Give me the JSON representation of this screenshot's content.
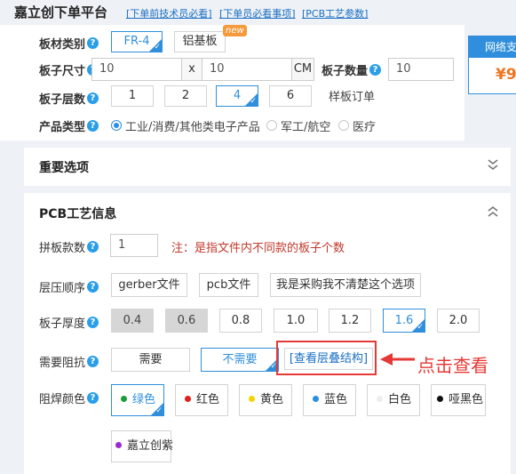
{
  "header": {
    "title": "嘉立创下单平台",
    "links": [
      "[下单前技术员必看]",
      "[下单员必看事项]",
      "[PCB工艺参数]"
    ]
  },
  "board_material": {
    "label": "板材类别",
    "options": [
      "FR-4",
      "铝基板"
    ],
    "selected": "FR-4",
    "new_badge": "new"
  },
  "board_size": {
    "label": "板子尺寸",
    "width": "10",
    "separator": "x",
    "height": "10",
    "unit": "CM"
  },
  "board_quantity": {
    "label": "板子数量",
    "value": "10"
  },
  "layers": {
    "label": "板子层数",
    "options": [
      "1",
      "2",
      "4",
      "6"
    ],
    "selected": "4",
    "sample_note": "样板订单"
  },
  "product_type": {
    "label": "产品类型",
    "options": [
      "工业/消费/其他类电子产品",
      "军工/航空",
      "医疗"
    ],
    "selected_index": 0
  },
  "price_card": {
    "title": "网络支",
    "value": "¥9"
  },
  "important_options": {
    "title": "重要选项"
  },
  "pcb_process": {
    "title": "PCB工艺信息",
    "panel_count": {
      "label": "拼板款数",
      "value": "1",
      "note": "注：是指文件内不同款的板子个数"
    },
    "stack_order": {
      "label": "层压顺序",
      "options": [
        "gerber文件",
        "pcb文件",
        "我是采购我不清楚这个选项"
      ]
    },
    "thickness": {
      "label": "板子厚度",
      "options": [
        "0.4",
        "0.6",
        "0.8",
        "1.0",
        "1.2",
        "1.6",
        "2.0"
      ],
      "selected": "1.6",
      "disabled": [
        "0.4",
        "0.6"
      ]
    },
    "impedance": {
      "label": "需要阻抗",
      "options": [
        "需要",
        "不需要"
      ],
      "selected": "不需要",
      "view_stackup": "[查看层叠结构]",
      "callout": "点击查看"
    },
    "solder_mask": {
      "label": "阻焊颜色",
      "options": [
        {
          "label": "绿色",
          "color": "#1a9c3a"
        },
        {
          "label": "红色",
          "color": "#e02020"
        },
        {
          "label": "黄色",
          "color": "#f2d500"
        },
        {
          "label": "蓝色",
          "color": "#2a8fe0"
        },
        {
          "label": "白色",
          "color": "#eeeeee"
        },
        {
          "label": "哑黑色",
          "color": "#111111"
        },
        {
          "label": "嘉立创紫",
          "color": "#9b2ad6"
        }
      ],
      "selected": "绿色"
    }
  },
  "help_icon_glyph": "?",
  "chevron_down_glyph": "⌄⌄",
  "chevron_up_glyph": "⌃⌃"
}
